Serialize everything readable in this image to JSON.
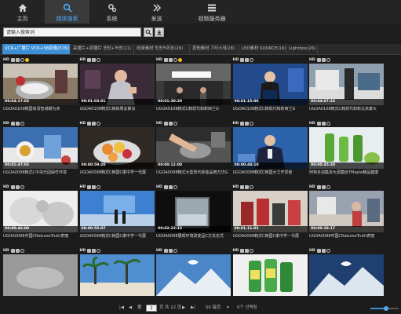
{
  "nav": {
    "items": [
      {
        "label": "主页",
        "icon": "home-icon"
      },
      {
        "label": "媒体搜索",
        "icon": "search-icon",
        "active": true
      },
      {
        "label": "系统",
        "icon": "gear-icon"
      },
      {
        "label": "发送",
        "icon": "chevrons-right-icon"
      },
      {
        "label": "视频服务器",
        "icon": "list-icon"
      }
    ]
  },
  "search": {
    "value": "请输入搜索词"
  },
  "tabs": [
    {
      "label": "VCR+广播片 VCR+5B影像(576)",
      "active": true
    },
    {
      "label": "采播片+原播片 동방+녹방(11)"
    },
    {
      "label": "收录素材 방송녹화본(26)"
    },
    {
      "label": "其他素材 기타소재(28)"
    },
    {
      "label": "LED素材 SOURCE(16)"
    },
    {
      "label": "Lightbox(26)"
    }
  ],
  "cards": [
    {
      "duration": "00:04:17:03",
      "title": "UGOA0109韩国高清智城朝为未",
      "badge": "yellow",
      "scene": "kitchen"
    },
    {
      "duration": "00:01:03:01",
      "title": "UGOA0108韩式C韩和朋友聚会",
      "badge": "none",
      "scene": "woman"
    },
    {
      "duration": "00:01:30:20",
      "title": "UGOA0108韩式C韩现代和新西兰G",
      "badge": "yellow",
      "scene": "lobby"
    },
    {
      "duration": "00:01:15:06",
      "title": "UGOA0108韩式C韩现代和新西兰G",
      "badge": "none",
      "scene": "speaker"
    },
    {
      "duration": "00:04:07:23",
      "title": "UGOA0108韩式C韩现代和新北京康大",
      "badge": "none",
      "scene": "shop"
    },
    {
      "duration": "00:01:47:02",
      "title": "UGOA0098韩式C中央乐园曲竹环境",
      "badge": "none",
      "scene": "food"
    },
    {
      "duration": "00:00:59:20",
      "title": "UGOA0098韩式C韩国C康中学一代展",
      "badge": "none",
      "scene": "fruit"
    },
    {
      "duration": "00:00:12:00",
      "title": "UGOA0098韩式大型现代新能品牌万华G",
      "badge": "none",
      "scene": "hand"
    },
    {
      "duration": "00:00:48:10",
      "title": "UGOA0098韩式C韩国大力开发者",
      "badge": "none",
      "scene": "anchor"
    },
    {
      "duration": "00:00:45:20",
      "title": "阿特多加集资大源菌丝TMaple精品健康",
      "badge": "none",
      "scene": "green"
    },
    {
      "duration": "00:00:46:00",
      "title": "UGOA0098中国CNaturesTruth表丽",
      "badge": "none",
      "scene": "blur"
    },
    {
      "duration": "00:00:55:07",
      "title": "UGOA0098韩式C韩国C康中学一代展",
      "badge": "none",
      "scene": "stage"
    },
    {
      "duration": "00:02:22:12",
      "title": "UGOA0098展现环境改变品C方关定式",
      "badge": "none",
      "scene": "tank"
    },
    {
      "duration": "00:01:11:02",
      "title": "UGOA0098韩式C韩国C康中学一代展",
      "badge": "none",
      "scene": "bottles"
    },
    {
      "duration": "00:00:19:17",
      "title": "UGOA0098中国CNaturesTruth表丽",
      "badge": "none",
      "scene": "room"
    },
    {
      "duration": "",
      "title": "",
      "badge": "none",
      "scene": "gray"
    },
    {
      "duration": "",
      "title": "",
      "badge": "none",
      "scene": "palms"
    },
    {
      "duration": "",
      "title": "",
      "badge": "none",
      "scene": "mountain"
    },
    {
      "duration": "",
      "title": "",
      "badge": "none",
      "scene": "jars"
    },
    {
      "duration": "",
      "title": "",
      "badge": "none",
      "scene": "mountain2"
    }
  ],
  "footer": {
    "page_current": "2",
    "page_prefix": "第",
    "page_total_text": "页 共 12 页",
    "per_page": "50 每页",
    "selected": "0个 선택됨",
    "zoom_level": 0.55
  },
  "colors": {
    "accent": "#3d8fd8",
    "active_nav": "#4fa9ff",
    "badge_yellow": "#f0c419"
  }
}
